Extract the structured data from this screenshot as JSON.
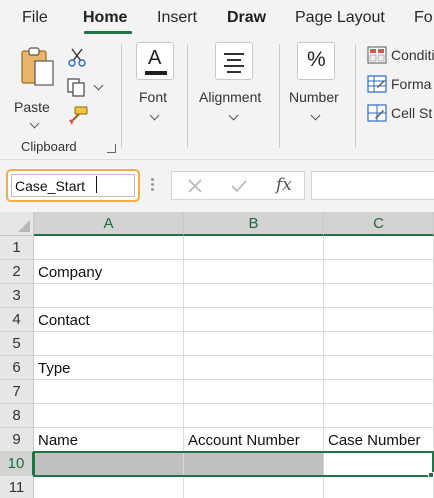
{
  "menu": {
    "tabs": [
      "File",
      "Home",
      "Insert",
      "Draw",
      "Page Layout",
      "Fo"
    ],
    "active": "Home"
  },
  "ribbon": {
    "clipboard": {
      "paste_label": "Paste",
      "group_label": "Clipboard"
    },
    "font": {
      "label": "Font"
    },
    "alignment": {
      "label": "Alignment"
    },
    "number": {
      "label": "Number",
      "icon_text": "%"
    },
    "styles": {
      "items": [
        "Conditi",
        "Forma",
        "Cell St"
      ]
    }
  },
  "formula_bar": {
    "name_box_value": "Case_Start",
    "fx_label": "fx",
    "formula_value": ""
  },
  "sheet": {
    "columns": [
      "A",
      "B",
      "C"
    ],
    "rows": [
      "1",
      "2",
      "3",
      "4",
      "5",
      "6",
      "7",
      "8",
      "9",
      "10",
      "11"
    ],
    "cells": {
      "A2": "Company",
      "A4": "Contact",
      "A6": "Type",
      "A9": "Name",
      "B9": "Account Number",
      "C9": "Case Number"
    },
    "active_row": "10",
    "active_column": "A",
    "selection": "A10:C10"
  },
  "colors": {
    "accent": "#217346",
    "name_box_highlight": "#f0b03f",
    "selection_fill": "#c0c0c0"
  }
}
